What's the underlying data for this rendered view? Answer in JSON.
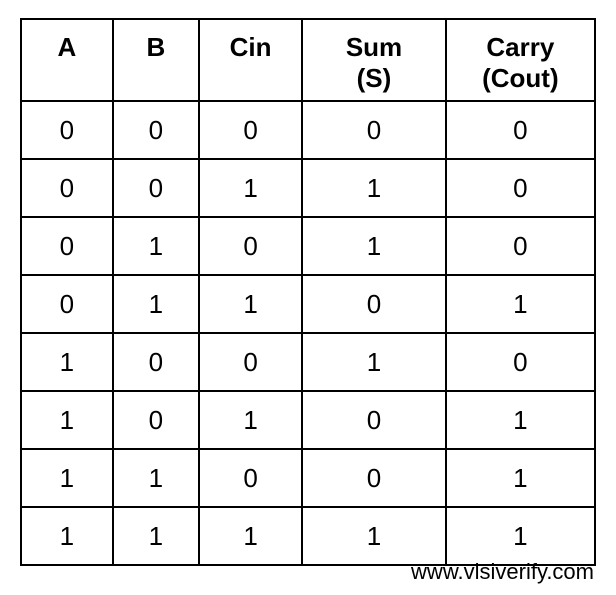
{
  "chart_data": {
    "type": "table",
    "columns": [
      {
        "main": "A",
        "sub": ""
      },
      {
        "main": "B",
        "sub": ""
      },
      {
        "main": "Cin",
        "sub": ""
      },
      {
        "main": "Sum",
        "sub": "(S)"
      },
      {
        "main": "Carry",
        "sub": "(Cout)"
      }
    ],
    "rows": [
      [
        "0",
        "0",
        "0",
        "0",
        "0"
      ],
      [
        "0",
        "0",
        "1",
        "1",
        "0"
      ],
      [
        "0",
        "1",
        "0",
        "1",
        "0"
      ],
      [
        "0",
        "1",
        "1",
        "0",
        "1"
      ],
      [
        "1",
        "0",
        "0",
        "1",
        "0"
      ],
      [
        "1",
        "0",
        "1",
        "0",
        "1"
      ],
      [
        "1",
        "1",
        "0",
        "0",
        "1"
      ],
      [
        "1",
        "1",
        "1",
        "1",
        "1"
      ]
    ]
  },
  "attribution": "www.vlsiverify.com"
}
